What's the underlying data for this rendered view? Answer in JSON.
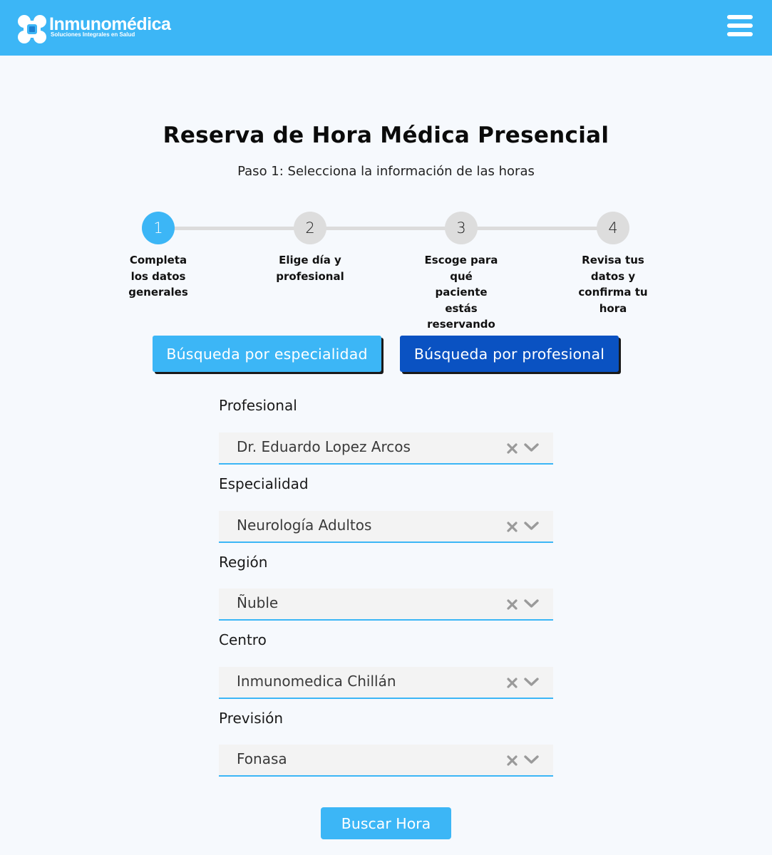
{
  "header": {
    "brand_name": "Inmunomédica",
    "brand_tagline": "Soluciones Integrales en Salud",
    "logo_icon": "flower-logo-icon",
    "menu_icon": "hamburger-menu-icon"
  },
  "page": {
    "title": "Reserva de Hora Médica Presencial",
    "subtitle": "Paso 1: Selecciona la información de las horas"
  },
  "steps": [
    {
      "number": "1",
      "label": "Completa los datos generales",
      "active": true
    },
    {
      "number": "2",
      "label": "Elige día y profesional",
      "active": false
    },
    {
      "number": "3",
      "label": "Escoge para qué paciente estás reservando",
      "active": false
    },
    {
      "number": "4",
      "label": "Revisa tus datos y confirma tu hora",
      "active": false
    }
  ],
  "search_modes": {
    "especialidad": "Búsqueda por especialidad",
    "profesional": "Búsqueda por profesional"
  },
  "form": {
    "fields": [
      {
        "label": "Profesional",
        "value": "Dr. Eduardo Lopez Arcos"
      },
      {
        "label": "Especialidad",
        "value": "Neurología Adultos"
      },
      {
        "label": "Región",
        "value": "Ñuble"
      },
      {
        "label": "Centro",
        "value": "Inmunomedica Chillán"
      },
      {
        "label": "Previsión",
        "value": "Fonasa"
      }
    ],
    "submit_label": "Buscar Hora"
  },
  "colors": {
    "primary": "#3cb6f6",
    "dark_blue": "#0a52c2",
    "step_inactive": "#dddddd",
    "icon_gray": "#9a9a9a"
  }
}
